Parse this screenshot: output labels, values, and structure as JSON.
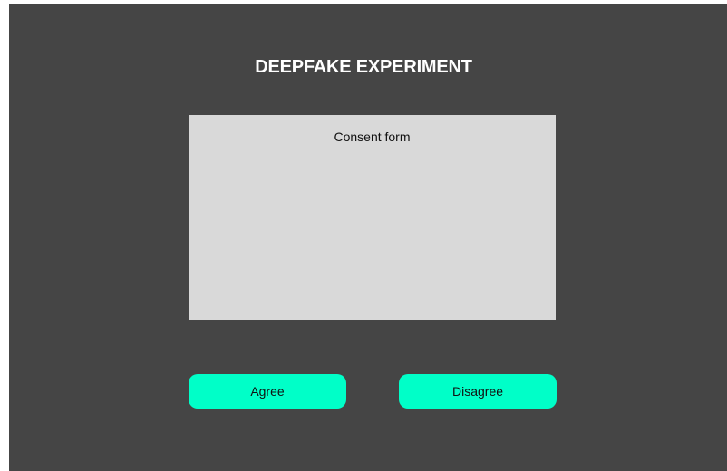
{
  "page": {
    "title": "DEEPFAKE EXPERIMENT"
  },
  "consent": {
    "heading": "Consent form"
  },
  "actions": {
    "agree_label": "Agree",
    "disagree_label": "Disagree"
  },
  "colors": {
    "background": "#454545",
    "panel": "#d9d9d9",
    "accent": "#00ffc8",
    "title_text": "#ffffff"
  }
}
